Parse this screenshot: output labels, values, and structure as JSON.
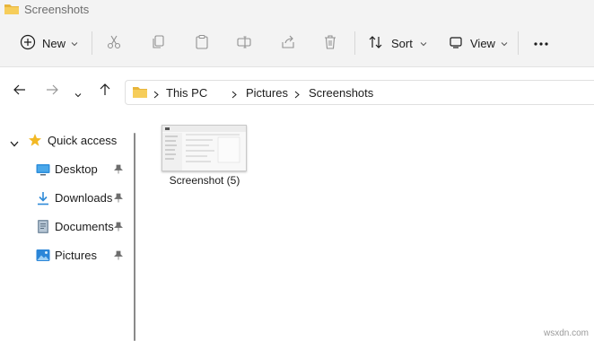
{
  "window": {
    "title": "Screenshots"
  },
  "toolbar": {
    "new_label": "New",
    "sort_label": "Sort",
    "view_label": "View"
  },
  "address": {
    "crumbs": [
      "This PC",
      "Pictures",
      "Screenshots"
    ]
  },
  "sidebar": {
    "quick_access_label": "Quick access",
    "items": [
      {
        "label": "Desktop",
        "icon": "desktop-icon"
      },
      {
        "label": "Downloads",
        "icon": "download-icon"
      },
      {
        "label": "Documents",
        "icon": "document-icon"
      },
      {
        "label": "Pictures",
        "icon": "pictures-icon"
      }
    ]
  },
  "files": [
    {
      "name": "Screenshot (5)"
    }
  ],
  "watermark": "wsxdn.com",
  "colors": {
    "folder_yellow": "#f0c24a",
    "accent_blue": "#2b79d6",
    "chrome_bg": "#f3f3f3"
  }
}
